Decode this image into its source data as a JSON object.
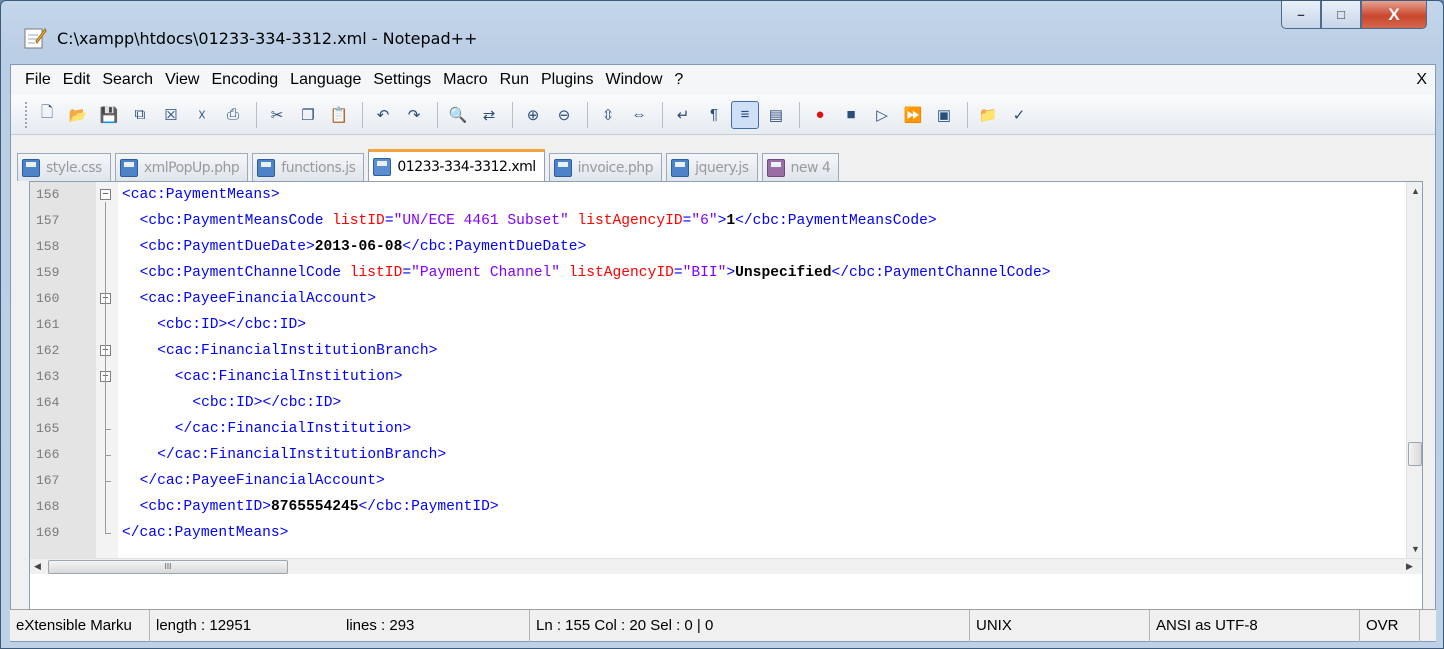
{
  "window": {
    "title": "C:\\xampp\\htdocs\\01233-334-3312.xml - Notepad++",
    "minimize_label": "–",
    "maximize_label": "□",
    "close_label": "X"
  },
  "menubar": {
    "items": [
      "File",
      "Edit",
      "Search",
      "View",
      "Encoding",
      "Language",
      "Settings",
      "Macro",
      "Run",
      "Plugins",
      "Window",
      "?"
    ],
    "close_doc_label": "X"
  },
  "toolbar": {
    "groups": [
      [
        "new-file-icon",
        "open-file-icon",
        "save-icon",
        "save-all-icon",
        "close-icon",
        "close-all-icon",
        "print-icon"
      ],
      [
        "cut-icon",
        "copy-icon",
        "paste-icon"
      ],
      [
        "undo-icon",
        "redo-icon"
      ],
      [
        "find-icon",
        "replace-icon"
      ],
      [
        "zoom-in-icon",
        "zoom-out-icon"
      ],
      [
        "sync-vertical-icon",
        "sync-horizontal-icon"
      ],
      [
        "word-wrap-icon",
        "show-all-chars-icon",
        "indent-guide-icon",
        "doc-map-icon"
      ],
      [
        "record-macro-icon",
        "stop-macro-icon",
        "play-macro-icon",
        "run-macro-multiple-icon",
        "save-macro-icon"
      ],
      [
        "folder-icon",
        "spell-check-icon"
      ]
    ],
    "glyphs": {
      "new-file-icon": "🗋",
      "open-file-icon": "📂",
      "save-icon": "💾",
      "save-all-icon": "⧉",
      "close-icon": "☒",
      "close-all-icon": "☓",
      "print-icon": "⎙",
      "cut-icon": "✂",
      "copy-icon": "❐",
      "paste-icon": "📋",
      "undo-icon": "↶",
      "redo-icon": "↷",
      "find-icon": "🔍",
      "replace-icon": "⇄",
      "zoom-in-icon": "⊕",
      "zoom-out-icon": "⊖",
      "sync-vertical-icon": "⇳",
      "sync-horizontal-icon": "⇔",
      "word-wrap-icon": "↵",
      "show-all-chars-icon": "¶",
      "indent-guide-icon": "≡",
      "doc-map-icon": "▤",
      "record-macro-icon": "●",
      "stop-macro-icon": "■",
      "play-macro-icon": "▷",
      "run-macro-multiple-icon": "⏩",
      "save-macro-icon": "▣",
      "folder-icon": "📁",
      "spell-check-icon": "✓"
    },
    "active": "indent-guide-icon"
  },
  "tabs": [
    {
      "label": "style.css",
      "active": false
    },
    {
      "label": "xmlPopUp.php",
      "active": false
    },
    {
      "label": "functions.js",
      "active": false
    },
    {
      "label": "01233-334-3312.xml",
      "active": true
    },
    {
      "label": "invoice.php",
      "active": false
    },
    {
      "label": "jquery.js",
      "active": false
    },
    {
      "label": "new  4",
      "active": false,
      "unsaved": true
    }
  ],
  "editor": {
    "lines": [
      {
        "n": "156",
        "indent": 0,
        "tokens": [
          [
            "tag",
            "<cac:PaymentMeans>"
          ]
        ]
      },
      {
        "n": "157",
        "indent": 2,
        "tokens": [
          [
            "tag",
            "<cbc:PaymentMeansCode "
          ],
          [
            "attr",
            "listID"
          ],
          [
            "tag",
            "="
          ],
          [
            "val",
            "\"UN/ECE 4461 Subset\""
          ],
          [
            "tag",
            " "
          ],
          [
            "attr",
            "listAgencyID"
          ],
          [
            "tag",
            "="
          ],
          [
            "val",
            "\"6\""
          ],
          [
            "tag",
            ">"
          ],
          [
            "txt",
            "1"
          ],
          [
            "tag",
            "</cbc:PaymentMeansCode>"
          ]
        ]
      },
      {
        "n": "158",
        "indent": 2,
        "tokens": [
          [
            "tag",
            "<cbc:PaymentDueDate>"
          ],
          [
            "txt",
            "2013-06-08"
          ],
          [
            "tag",
            "</cbc:PaymentDueDate>"
          ]
        ]
      },
      {
        "n": "159",
        "indent": 2,
        "tokens": [
          [
            "tag",
            "<cbc:PaymentChannelCode "
          ],
          [
            "attr",
            "listID"
          ],
          [
            "tag",
            "="
          ],
          [
            "val",
            "\"Payment Channel\""
          ],
          [
            "tag",
            " "
          ],
          [
            "attr",
            "listAgencyID"
          ],
          [
            "tag",
            "="
          ],
          [
            "val",
            "\"BII\""
          ],
          [
            "tag",
            ">"
          ],
          [
            "txt",
            "Unspecified"
          ],
          [
            "tag",
            "</cbc:PaymentChannelCode>"
          ]
        ]
      },
      {
        "n": "160",
        "indent": 2,
        "tokens": [
          [
            "tag",
            "<cac:PayeeFinancialAccount>"
          ]
        ]
      },
      {
        "n": "161",
        "indent": 4,
        "tokens": [
          [
            "tag",
            "<cbc:ID></cbc:ID>"
          ]
        ]
      },
      {
        "n": "162",
        "indent": 4,
        "tokens": [
          [
            "tag",
            "<cac:FinancialInstitutionBranch>"
          ]
        ]
      },
      {
        "n": "163",
        "indent": 6,
        "tokens": [
          [
            "tag",
            "<cac:FinancialInstitution>"
          ]
        ]
      },
      {
        "n": "164",
        "indent": 8,
        "tokens": [
          [
            "tag",
            "<cbc:ID></cbc:ID>"
          ]
        ]
      },
      {
        "n": "165",
        "indent": 6,
        "tokens": [
          [
            "tag",
            "</cac:FinancialInstitution>"
          ]
        ]
      },
      {
        "n": "166",
        "indent": 4,
        "tokens": [
          [
            "tag",
            "</cac:FinancialInstitutionBranch>"
          ]
        ]
      },
      {
        "n": "167",
        "indent": 2,
        "tokens": [
          [
            "tag",
            "</cac:PayeeFinancialAccount>"
          ]
        ]
      },
      {
        "n": "168",
        "indent": 2,
        "tokens": [
          [
            "tag",
            "<cbc:PaymentID>"
          ],
          [
            "txt",
            "8765554245"
          ],
          [
            "tag",
            "</cbc:PaymentID>"
          ]
        ]
      },
      {
        "n": "169",
        "indent": 0,
        "tokens": [
          [
            "tag",
            "</cac:PaymentMeans>"
          ]
        ]
      }
    ],
    "scroll_h_thumb_label": "III"
  },
  "statusbar": {
    "language": "eXtensible Marku",
    "length": "length : 12951",
    "lines": "lines : 293",
    "position": "Ln : 155    Col : 20    Sel : 0 | 0",
    "eol": "UNIX",
    "encoding": "ANSI as UTF-8",
    "mode": "OVR"
  }
}
